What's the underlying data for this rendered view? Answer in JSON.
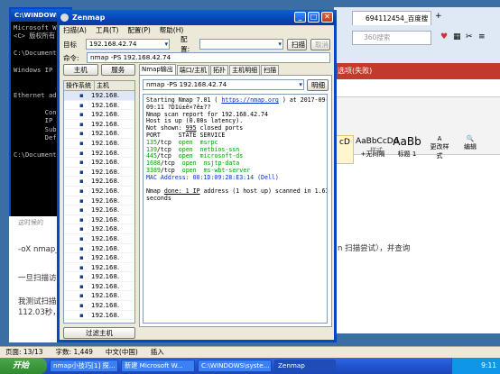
{
  "cmd": {
    "title": "C:\\WINDOWS\\",
    "lines": [
      "Microsoft Wi",
      "<C> 版权所有",
      "",
      "C:\\Documents",
      "",
      "Windows IP C",
      "",
      "",
      "Ethernet ada",
      "",
      "        Conn",
      "        IP A",
      "        Subn",
      "        Defa",
      "",
      "C:\\Documents"
    ]
  },
  "browser": {
    "tab_label": "694112454_百度搜",
    "search_placeholder": "360搜索"
  },
  "word": {
    "redbar": "选项(失败)",
    "styles": [
      "cD",
      "AaBbCcDd",
      "AaBb"
    ],
    "style_names": [
      "",
      "+无间隔",
      "标题 1"
    ],
    "group_label": "样式",
    "right_labels": [
      "更改样式",
      "编辑"
    ],
    "snippet": "n 扫描尝试），并查询"
  },
  "leftdoc": {
    "lines": [
      "-oX nmap_",
      "一旦扫描访",
      "我测试扫描",
      "112.03秒，"
    ],
    "fragment": "这时候的"
  },
  "zenmap": {
    "title": "Zenmap",
    "menu": [
      "扫描(A)",
      "工具(T)",
      "配置(P)",
      "帮助(H)"
    ],
    "target_label": "目标",
    "target_value": "192.168.42.74",
    "profile_label": "配置:",
    "profile_value": "",
    "scan_button": "扫描",
    "cancel_button": "取消",
    "command_label": "命令:",
    "command_value": "nmap -PS 192.168.42.74",
    "host_toggle": [
      "主机",
      "服务"
    ],
    "host_columns": [
      "操作系统",
      "主机"
    ],
    "hosts": [
      "192.168.",
      "192.168.",
      "192.168.",
      "192.168.",
      "192.168.",
      "192.168.",
      "192.168.",
      "192.168.",
      "192.168.",
      "192.168.",
      "192.168.",
      "192.168.",
      "192.168.",
      "192.168.",
      "192.168.",
      "192.168.",
      "192.168.",
      "192.168.",
      "192.168.",
      "192.168.",
      "192.168.",
      "192.168.",
      "192.168.",
      "192.168."
    ],
    "filter_button": "过滤主机",
    "tabs": [
      "Nmap输出",
      "端口/主机",
      "拓扑",
      "主机明细",
      "扫描"
    ],
    "output_select": "nmap -PS 192.168.42.74",
    "details_button": "明细",
    "output": {
      "l1a": "Starting Nmap 7.01 ( ",
      "l1link": "https://nmap.org",
      "l1b": " ) at 2017-09-26",
      "l2": "09:11 ?D1ú±ê×?ê±??",
      "l3": "Nmap scan report for 192.168.42.74",
      "l4": "Host is up (0.00s latency).",
      "l5a": "Not shown: ",
      "l5u": "995",
      "l5b": " closed ports",
      "l6": "PORT     STATE SERVICE",
      "ports": [
        {
          "port": "135",
          "proto": "/tcp",
          "state": "open",
          "service": "msrpc"
        },
        {
          "port": "139",
          "proto": "/tcp",
          "state": "open",
          "service": "netbios-ssn"
        },
        {
          "port": "445",
          "proto": "/tcp",
          "state": "open",
          "service": "microsoft-ds"
        },
        {
          "port": "1688",
          "proto": "/tcp",
          "state": "open",
          "service": "nsjtp-data"
        },
        {
          "port": "3389",
          "proto": "/tcp",
          "state": "open",
          "service": "ms-wbt-server"
        }
      ],
      "mac": "MAC Address: 00:1D:09:28:E3:14 (Dell)",
      "done_a": "Nmap ",
      "done_u": "done: 1 IP",
      "done_b": " address (1 host up) scanned in 1.63",
      "done_c": "seconds"
    }
  },
  "word_status": {
    "page": "页面: 13/13",
    "words": "字数: 1,449",
    "lang": "中文(中国)",
    "mode": "插入"
  },
  "taskbar": {
    "start": "开始",
    "tasks": [
      "nmap小技巧[1]  探...",
      "新建 Microsoft W...",
      "C:\\WINDOWS\\syste...",
      "Zenmap"
    ],
    "time": "9:11"
  }
}
